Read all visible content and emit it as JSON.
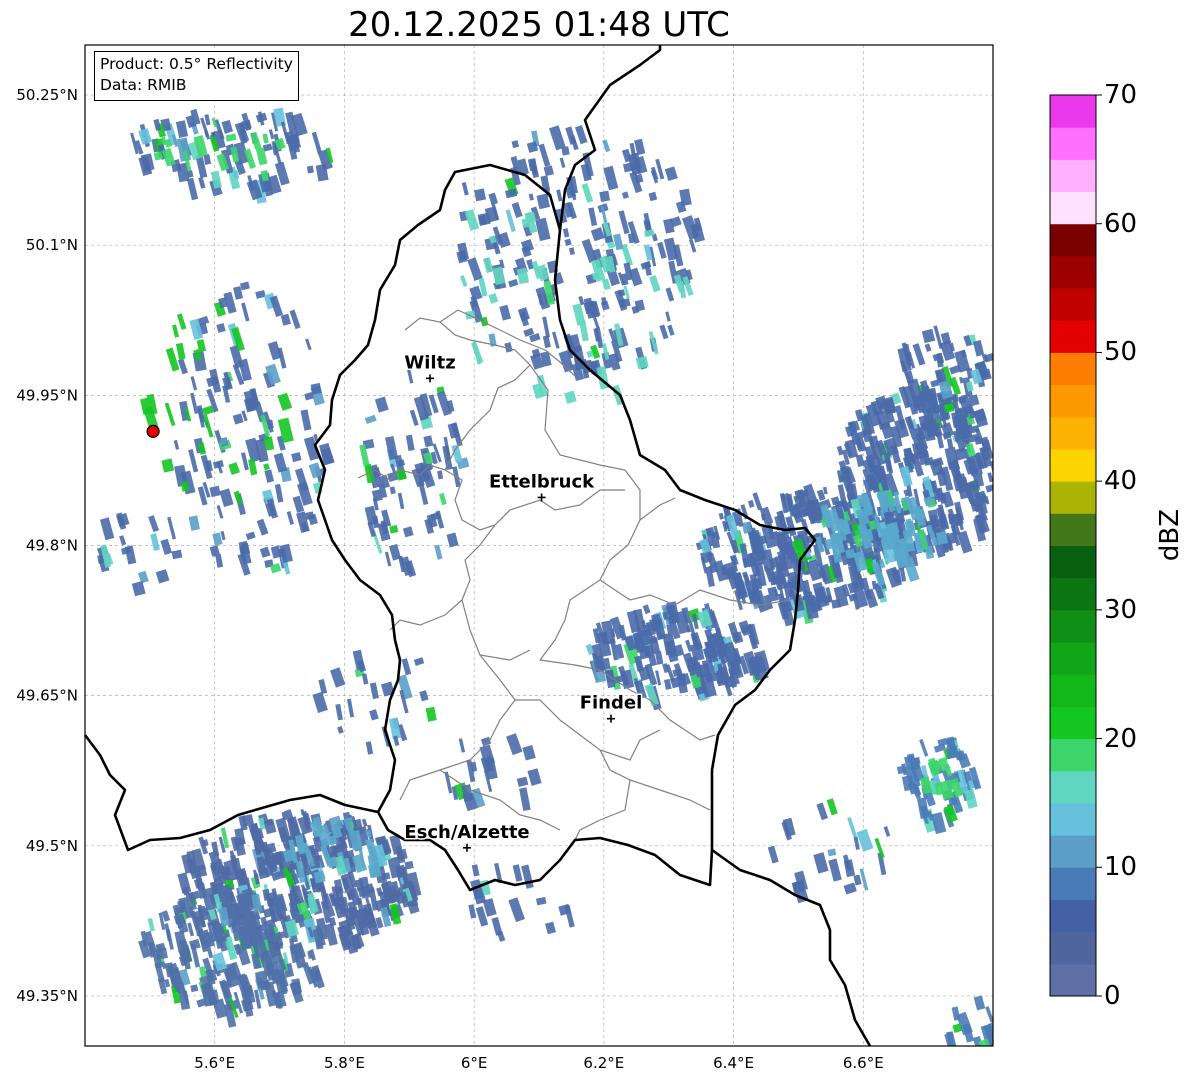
{
  "title": "20.12.2025 01:48 UTC",
  "info": {
    "product": "Product: 0.5° Reflectivity",
    "source": "Data: RMIB"
  },
  "map": {
    "lon_range": [
      5.4,
      6.8
    ],
    "lat_range": [
      49.3,
      50.3
    ],
    "lon_ticks": [
      {
        "value": 5.6,
        "label": "5.6°E"
      },
      {
        "value": 5.8,
        "label": "5.8°E"
      },
      {
        "value": 6.0,
        "label": "6°E"
      },
      {
        "value": 6.2,
        "label": "6.2°E"
      },
      {
        "value": 6.4,
        "label": "6.4°E"
      },
      {
        "value": 6.6,
        "label": "6.6°E"
      }
    ],
    "lat_ticks": [
      {
        "value": 49.35,
        "label": "49.35°N"
      },
      {
        "value": 49.5,
        "label": "49.5°N"
      },
      {
        "value": 49.65,
        "label": "49.65°N"
      },
      {
        "value": 49.8,
        "label": "49.8°N"
      },
      {
        "value": 49.95,
        "label": "49.95°N"
      },
      {
        "value": 50.1,
        "label": "50.1°N"
      },
      {
        "value": 50.25,
        "label": "50.25°N"
      }
    ],
    "grid": true,
    "radar_site": {
      "lon": 5.505,
      "lat": 49.914
    },
    "cities": [
      {
        "name": "Wiltz",
        "lon": 5.932,
        "lat": 49.967
      },
      {
        "name": "Ettelbruck",
        "lon": 6.104,
        "lat": 49.848
      },
      {
        "name": "Findel",
        "lon": 6.211,
        "lat": 49.627
      },
      {
        "name": "Esch/Alzette",
        "lon": 5.989,
        "lat": 49.498
      }
    ]
  },
  "colorbar": {
    "label": "dBZ",
    "min": 0,
    "max": 70,
    "ticks": [
      {
        "value": 0,
        "label": "0"
      },
      {
        "value": 10,
        "label": "10"
      },
      {
        "value": 20,
        "label": "20"
      },
      {
        "value": 30,
        "label": "30"
      },
      {
        "value": 40,
        "label": "40"
      },
      {
        "value": 50,
        "label": "50"
      },
      {
        "value": 60,
        "label": "60"
      },
      {
        "value": 70,
        "label": "70"
      }
    ],
    "colors": [
      "#5e70a5",
      "#50659d",
      "#4360a5",
      "#4a7bb7",
      "#5b9ec8",
      "#65c1dc",
      "#60d5c0",
      "#3bd56a",
      "#12c720",
      "#12b71a",
      "#11a518",
      "#0f8f15",
      "#0c7712",
      "#096110",
      "#42781a",
      "#abb304",
      "#fcd400",
      "#fcb204",
      "#fc9800",
      "#fc7e00",
      "#e30000",
      "#c10000",
      "#9d0000",
      "#7b0000",
      "#ffe0ff",
      "#ffb1ff",
      "#ff70ff",
      "#eb38eb"
    ]
  },
  "echoes": [
    {
      "lon": 5.72,
      "lat": 49.47,
      "rx": 0.18,
      "ry": 0.07,
      "color": "#4f6aa5",
      "density": 0.75
    },
    {
      "lon": 5.62,
      "lat": 49.4,
      "rx": 0.14,
      "ry": 0.06,
      "color": "#5070a8",
      "density": 0.6
    },
    {
      "lon": 5.78,
      "lat": 49.5,
      "rx": 0.08,
      "ry": 0.03,
      "color": "#5aa9cc",
      "density": 0.35
    },
    {
      "lon": 6.3,
      "lat": 49.7,
      "rx": 0.14,
      "ry": 0.045,
      "color": "#4a6aa8",
      "density": 0.75
    },
    {
      "lon": 6.5,
      "lat": 49.8,
      "rx": 0.16,
      "ry": 0.06,
      "color": "#4a6aa8",
      "density": 0.8
    },
    {
      "lon": 6.68,
      "lat": 49.88,
      "rx": 0.13,
      "ry": 0.08,
      "color": "#4a6aa8",
      "density": 0.75
    },
    {
      "lon": 6.62,
      "lat": 49.82,
      "rx": 0.1,
      "ry": 0.04,
      "color": "#5aa9cc",
      "density": 0.45
    },
    {
      "lon": 6.72,
      "lat": 49.97,
      "rx": 0.08,
      "ry": 0.05,
      "color": "#4a6aa8",
      "density": 0.5
    },
    {
      "lon": 6.71,
      "lat": 49.57,
      "rx": 0.06,
      "ry": 0.04,
      "color": "#4a7bb7",
      "density": 0.6
    },
    {
      "lon": 6.71,
      "lat": 49.57,
      "rx": 0.025,
      "ry": 0.02,
      "color": "#3bd56a",
      "density": 0.6
    },
    {
      "lon": 5.62,
      "lat": 50.2,
      "rx": 0.16,
      "ry": 0.04,
      "color": "#4a6aa8",
      "density": 0.35
    },
    {
      "lon": 5.62,
      "lat": 50.2,
      "rx": 0.12,
      "ry": 0.03,
      "color": "#3bd56a",
      "density": 0.12
    },
    {
      "lon": 6.15,
      "lat": 50.1,
      "rx": 0.2,
      "ry": 0.12,
      "color": "#4a6aa8",
      "density": 0.22
    },
    {
      "lon": 6.15,
      "lat": 50.05,
      "rx": 0.18,
      "ry": 0.1,
      "color": "#60d5c0",
      "density": 0.06
    },
    {
      "lon": 5.65,
      "lat": 49.92,
      "rx": 0.12,
      "ry": 0.15,
      "color": "#4a6aa8",
      "density": 0.18
    },
    {
      "lon": 5.6,
      "lat": 49.95,
      "rx": 0.12,
      "ry": 0.1,
      "color": "#12c720",
      "density": 0.06
    },
    {
      "lon": 5.9,
      "lat": 49.88,
      "rx": 0.08,
      "ry": 0.1,
      "color": "#4a6aa8",
      "density": 0.25
    },
    {
      "lon": 5.85,
      "lat": 49.65,
      "rx": 0.1,
      "ry": 0.05,
      "color": "#4a6aa8",
      "density": 0.14
    },
    {
      "lon": 6.02,
      "lat": 49.58,
      "rx": 0.07,
      "ry": 0.04,
      "color": "#4a6aa8",
      "density": 0.2
    },
    {
      "lon": 6.05,
      "lat": 49.45,
      "rx": 0.1,
      "ry": 0.04,
      "color": "#4a6aa8",
      "density": 0.12
    },
    {
      "lon": 6.8,
      "lat": 49.32,
      "rx": 0.08,
      "ry": 0.04,
      "color": "#4a7bb7",
      "density": 0.4
    },
    {
      "lon": 6.55,
      "lat": 49.5,
      "rx": 0.1,
      "ry": 0.05,
      "color": "#4a6aa8",
      "density": 0.12
    },
    {
      "lon": 5.47,
      "lat": 49.8,
      "rx": 0.07,
      "ry": 0.05,
      "color": "#4a6aa8",
      "density": 0.15
    }
  ]
}
